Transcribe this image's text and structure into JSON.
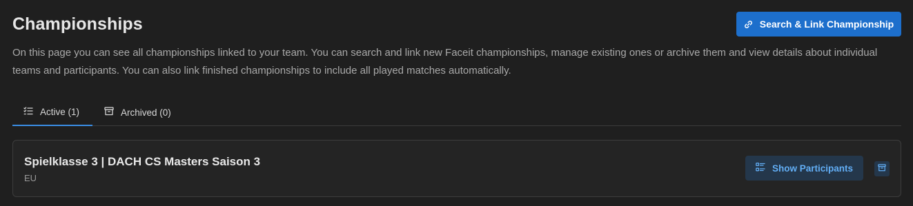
{
  "header": {
    "title": "Championships",
    "link_button_label": "Search & Link Championship",
    "description": "On this page you can see all championships linked to your team. You can search and link new Faceit championships, manage existing ones or archive them and view details about individual teams and participants. You can also link finished championships to include all played matches automatically."
  },
  "tabs": [
    {
      "label": "Active (1)",
      "icon": "list-check-icon",
      "active": true
    },
    {
      "label": "Archived (0)",
      "icon": "archive-icon",
      "active": false
    }
  ],
  "championships": [
    {
      "name": "Spielklasse 3 | DACH CS Masters Saison 3",
      "region": "EU",
      "show_participants_label": "Show Participants",
      "archive_icon": "archive-icon"
    }
  ],
  "colors": {
    "background": "#1f1f1f",
    "primary": "#1d6fcc",
    "tab_underline": "#3a8ee6",
    "secondary_button_bg": "#24374b",
    "secondary_button_text": "#62aef5"
  }
}
